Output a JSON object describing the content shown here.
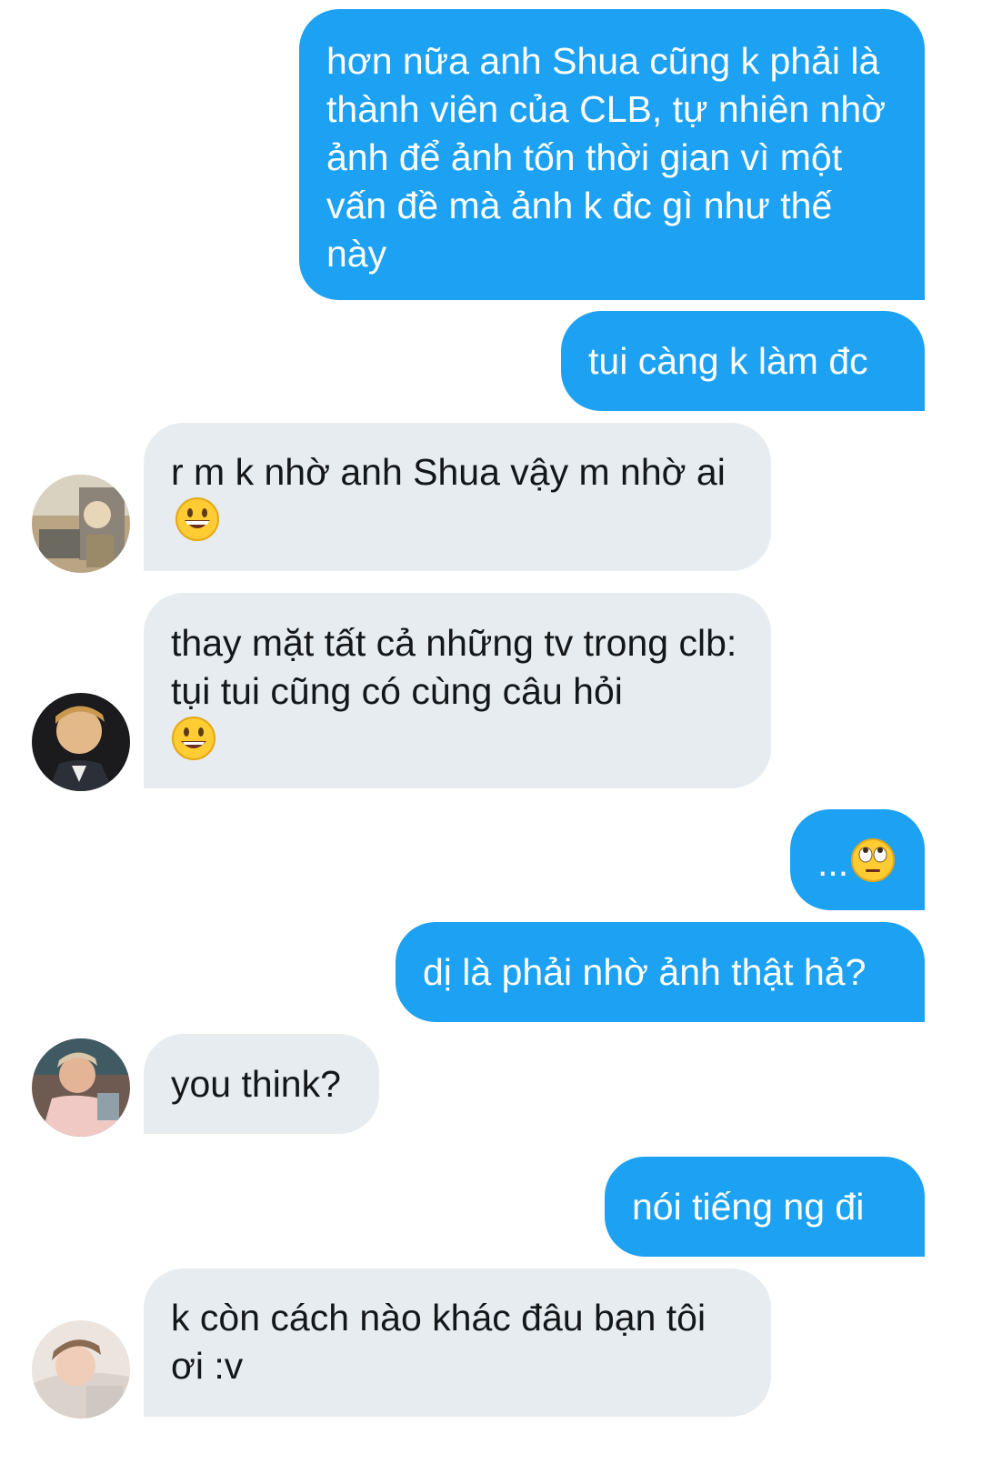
{
  "messages": [
    {
      "from": "me",
      "text": "hơn nữa anh Shua cũng k phải là thành viên của CLB, tự nhiên nhờ ảnh để ảnh tốn thời gian vì một vấn đề mà ảnh k đc gì như thế này"
    },
    {
      "from": "me",
      "text": "tui càng k làm đc"
    },
    {
      "from": "other",
      "text": "r m k nhờ anh Shua vậy m nhờ ai",
      "emoji": "grinning-face"
    },
    {
      "from": "other",
      "text": "thay mặt tất cả những tv trong clb: tụi tui cũng có cùng câu hỏi",
      "emoji": "smiling-face"
    },
    {
      "from": "me",
      "text": "...",
      "emoji": "rolling-eyes-face"
    },
    {
      "from": "me",
      "text": "dị là phải nhờ ảnh thật hả?"
    },
    {
      "from": "other",
      "text": "you think?"
    },
    {
      "from": "me",
      "text": "nói tiếng ng đi"
    },
    {
      "from": "other",
      "text": "k còn cách nào khác đâu bạn tôi ơi :v"
    }
  ],
  "colors": {
    "outgoing_bubble": "#1da1f2",
    "incoming_bubble": "#e6ecf0",
    "outgoing_text": "#ffffff",
    "incoming_text": "#14171a"
  }
}
